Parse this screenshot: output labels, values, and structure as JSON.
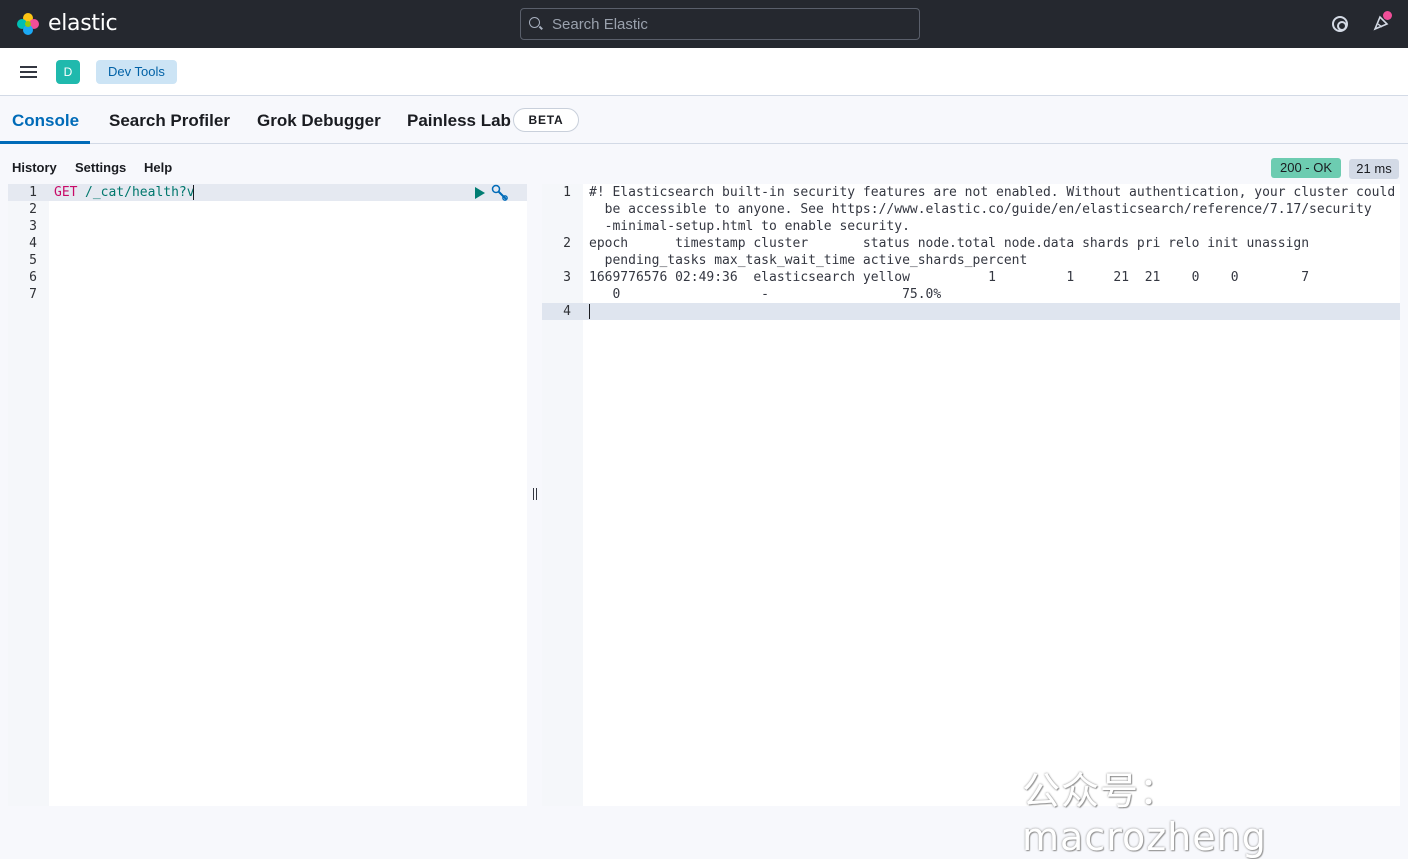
{
  "header": {
    "brand": "elastic",
    "search_placeholder": "Search Elastic"
  },
  "subheader": {
    "avatar_letter": "D",
    "breadcrumb": "Dev Tools"
  },
  "tabs": [
    {
      "label": "Console",
      "active": true
    },
    {
      "label": "Search Profiler"
    },
    {
      "label": "Grok Debugger"
    },
    {
      "label": "Painless Lab"
    }
  ],
  "beta_badge": "BETA",
  "console_menu": {
    "history": "History",
    "settings": "Settings",
    "help": "Help"
  },
  "response_status": {
    "status": "200 - OK",
    "time": "21 ms"
  },
  "request_editor": {
    "line_numbers": [
      "1",
      "2",
      "3",
      "4",
      "5",
      "6",
      "7"
    ],
    "method": "GET",
    "path": "/_cat/health?v"
  },
  "response_output": {
    "line_numbers": [
      "1",
      "2",
      "3",
      "4"
    ],
    "lines": [
      "#! Elasticsearch built-in security features are not enabled. Without authentication, your cluster could",
      "  be accessible to anyone. See https://www.elastic.co/guide/en/elasticsearch/reference/7.17/security",
      "  -minimal-setup.html to enable security.",
      "epoch      timestamp cluster       status node.total node.data shards pri relo init unassign",
      "  pending_tasks max_task_wait_time active_shards_percent",
      "1669776576 02:49:36  elasticsearch yellow          1         1     21  21    0    0        7",
      "   0                  -                 75.0%"
    ]
  },
  "watermark": "公众号：macrozheng",
  "colors": {
    "accent": "#006bb8",
    "status_ok": "#6dccb1",
    "topbar": "#25282f"
  }
}
